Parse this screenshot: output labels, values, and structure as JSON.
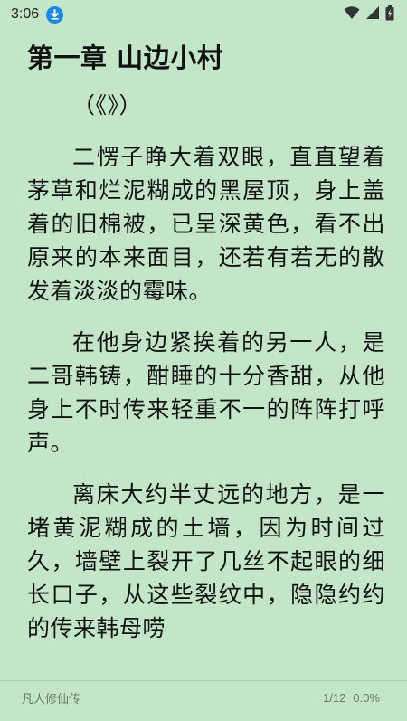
{
  "status_bar": {
    "time": "3:06",
    "icons": [
      "download-icon",
      "wifi-icon",
      "cellular-signal-icon",
      "battery-charging-icon"
    ]
  },
  "reader": {
    "chapter_title": "第一章 山边小村",
    "paragraphs": [
      "（《》）",
      "二愣子睁大着双眼，直直望着茅草和烂泥糊成的黑屋顶，身上盖着的旧棉被，已呈深黄色，看不出原来的本来面目，还若有若无的散发着淡淡的霉味。",
      "在他身边紧挨着的另一人，是二哥韩铸，酣睡的十分香甜，从他身上不时传来轻重不一的阵阵打呼声。",
      "离床大约半丈远的地方，是一堵黄泥糊成的土墙，因为时间过久，墙壁上裂开了几丝不起眼的细长口子，从这些裂纹中，隐隐约约的传来韩母唠"
    ]
  },
  "footer": {
    "book_title": "凡人修仙传",
    "page": "1/12",
    "progress": "0.0%"
  },
  "colors": {
    "background": "#c2e6c7",
    "text": "#111111",
    "footer_text": "#667766",
    "accent": "#1e88e5"
  }
}
